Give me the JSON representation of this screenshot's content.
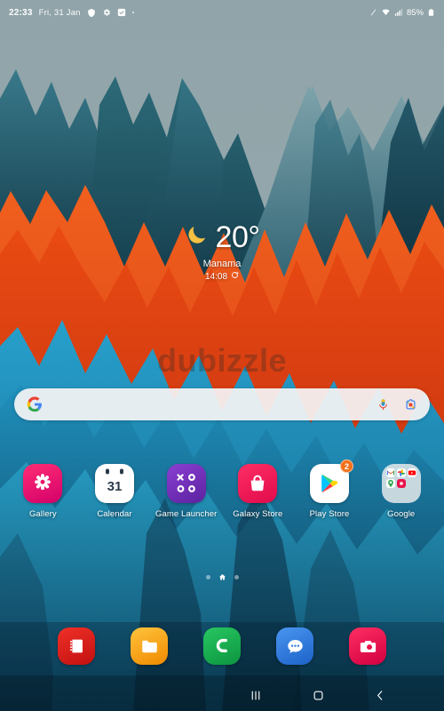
{
  "statusbar": {
    "time": "22:33",
    "date": "Fri, 31 Jan",
    "icons": [
      "shield-icon",
      "gear-icon",
      "checkbox-icon"
    ],
    "battery_text": "85%",
    "right_icons": [
      "slash-icon",
      "wifi-icon",
      "signal-icon",
      "battery-icon"
    ]
  },
  "weather": {
    "icon": "crescent-moon-icon",
    "temperature": "20°",
    "city": "Manama",
    "time": "14:08",
    "refresh_icon": "refresh-icon"
  },
  "watermark": {
    "text": "dubizzle"
  },
  "search": {
    "google_logo": "google-g-icon",
    "placeholder": "",
    "value": "",
    "mic_icon": "microphone-icon",
    "lens_icon": "google-lens-icon"
  },
  "apps": [
    {
      "label": "Gallery",
      "icon": "gallery-icon",
      "color": "#e6156b",
      "badge": null
    },
    {
      "label": "Calendar",
      "icon": "calendar-icon",
      "color": "#ffffff",
      "badge": null,
      "day": "31"
    },
    {
      "label": "Game Launcher",
      "icon": "game-launcher-icon",
      "color": "#6b2fb5",
      "badge": null
    },
    {
      "label": "Galaxy Store",
      "icon": "galaxy-store-icon",
      "color": "#f4245e",
      "badge": null
    },
    {
      "label": "Play Store",
      "icon": "play-store-icon",
      "color": "#ffffff",
      "badge": "2"
    },
    {
      "label": "Google",
      "icon": "google-folder-icon",
      "color": "#eeeeee",
      "badge": null
    }
  ],
  "google_folder": [
    {
      "name": "gmail-icon",
      "color": "#ffffff",
      "glyph": "M"
    },
    {
      "name": "photos-icon",
      "color": "#ffffff",
      "glyph": "*"
    },
    {
      "name": "youtube-icon",
      "color": "#ffffff",
      "glyph": "▶"
    },
    {
      "name": "maps-icon",
      "color": "#ffffff",
      "glyph": "◉"
    },
    {
      "name": "drive-icon",
      "color": "#e8134b",
      "glyph": "■"
    }
  ],
  "page_indicator": {
    "dots": [
      "page-dot-left",
      "home-page-icon",
      "page-dot-right"
    ],
    "active_index": 1
  },
  "dock": [
    {
      "label": "Samsung Notes",
      "icon": "notes-icon",
      "color": "#e02020"
    },
    {
      "label": "My Files",
      "icon": "files-icon",
      "color": "#f5a623"
    },
    {
      "label": "Phone",
      "icon": "phone-icon",
      "color": "#17a84a"
    },
    {
      "label": "Messages",
      "icon": "messages-icon",
      "color": "#2f7ee8"
    },
    {
      "label": "Camera",
      "icon": "camera-icon",
      "color": "#e8134b"
    }
  ],
  "navbar": {
    "recents": {
      "icon": "recents-icon",
      "label": "Recents"
    },
    "home": {
      "icon": "home-icon",
      "label": "Home"
    },
    "back": {
      "icon": "back-icon",
      "label": "Back"
    }
  },
  "theme": {
    "sky": "#8fa3a8",
    "accent_orange": "#e8501b",
    "teal_dark": "#134b5a",
    "blue_mid": "#1e8bb5",
    "badge_color": "#f2711c"
  }
}
